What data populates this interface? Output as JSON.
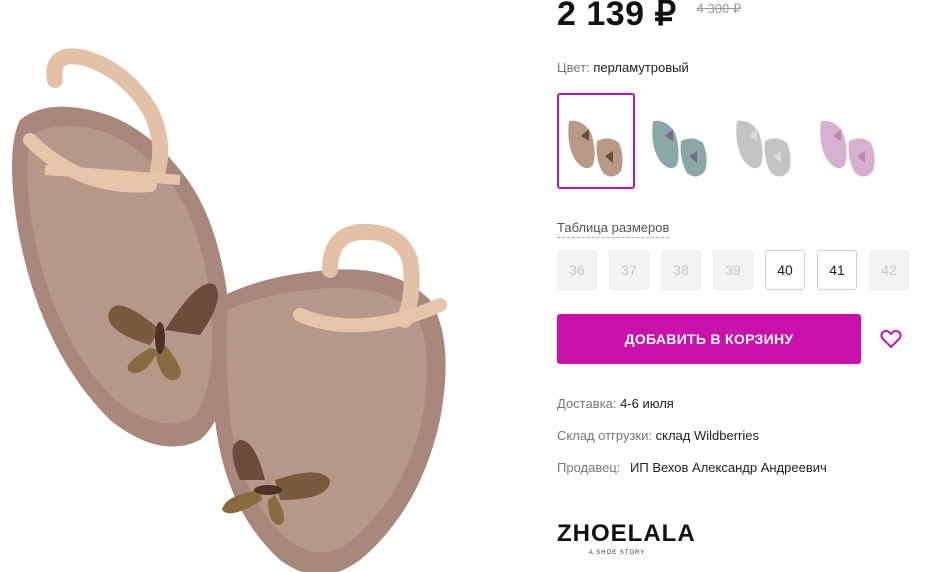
{
  "price": {
    "current": "2 139 ₽",
    "old": "4 300 ₽"
  },
  "color": {
    "label": "Цвет:",
    "value": "перламутровый"
  },
  "swatches": [
    {
      "icon": "sandal-rose-icon",
      "color": "#b89a86",
      "active": true
    },
    {
      "icon": "sandal-teal-icon",
      "color": "#8aa8a8",
      "active": false
    },
    {
      "icon": "sandal-clear-icon",
      "color": "#bcbcbc",
      "active": false
    },
    {
      "icon": "sandal-pink-icon",
      "color": "#d8b0cf",
      "active": false
    }
  ],
  "size_table_link": "Таблица размеров",
  "sizes": [
    {
      "label": "36",
      "available": false
    },
    {
      "label": "37",
      "available": false
    },
    {
      "label": "38",
      "available": false
    },
    {
      "label": "39",
      "available": false
    },
    {
      "label": "40",
      "available": true
    },
    {
      "label": "41",
      "available": true
    },
    {
      "label": "42",
      "available": false
    }
  ],
  "add_to_cart": "ДОБАВИТЬ В КОРЗИНУ",
  "delivery": {
    "label": "Доставка:",
    "value": "4-6 июля"
  },
  "warehouse": {
    "label": "Склад отгрузки:",
    "value": "склад Wildberries"
  },
  "seller": {
    "label": "Продавец:",
    "value": "ИП Вехов Александр Андреевич"
  },
  "brand": {
    "name": "ZHOELALA",
    "tagline": "A SHOE STORY"
  },
  "colors": {
    "accent": "#cb11ab",
    "active_border": "#b614b3"
  }
}
